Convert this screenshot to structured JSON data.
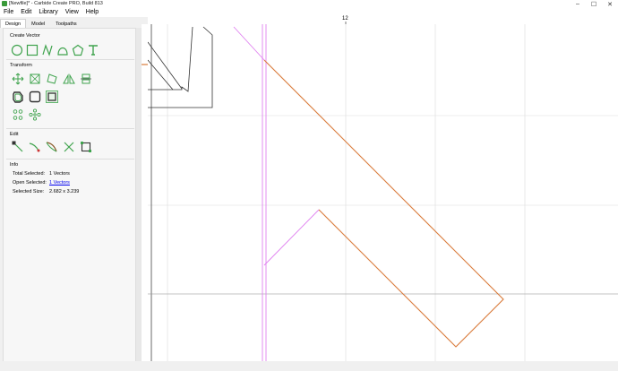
{
  "window": {
    "title": "[Newfile]* - Carbide Create PRO, Build 813",
    "controls": {
      "minimize": "–",
      "maximize": "☐",
      "close": "✕"
    }
  },
  "menu": [
    "File",
    "Edit",
    "Library",
    "View",
    "Help"
  ],
  "tabs": [
    "Design",
    "Model",
    "Toolpaths"
  ],
  "sections": {
    "create_vector": "Create Vector",
    "transform": "Transform",
    "edit": "Edit",
    "info": "Info"
  },
  "icons": {
    "create_vector": [
      "circle-icon",
      "rectangle-icon",
      "polyline-icon",
      "curve-icon",
      "polygon-icon",
      "text-icon"
    ],
    "transform_row1": [
      "move-icon",
      "scale-icon",
      "rotate-icon",
      "mirror-icon",
      "align-icon"
    ],
    "transform_row2": [
      "offset-icon",
      "fillet-icon",
      "boolean-icon"
    ],
    "transform_row3": [
      "circular-array-icon",
      "linear-array-icon"
    ],
    "edit": [
      "node-edit-icon",
      "trim-icon",
      "curve-edit-icon",
      "cut-icon",
      "join-icon"
    ]
  },
  "info": {
    "total_selected_label": "Total Selected:",
    "total_selected_value": "1 Vectors",
    "open_selected_label": "Open Selected:",
    "open_selected_value": "1 Vectors",
    "selected_size_label": "Selected Size:",
    "selected_size_value": "2.682 x 3.239"
  },
  "ruler": {
    "top_label": "12"
  },
  "colors": {
    "accent_green": "#3fa34d",
    "selection_orange": "#d97a3a",
    "guide_magenta": "#e080f0",
    "grid": "#dcdcdc"
  }
}
